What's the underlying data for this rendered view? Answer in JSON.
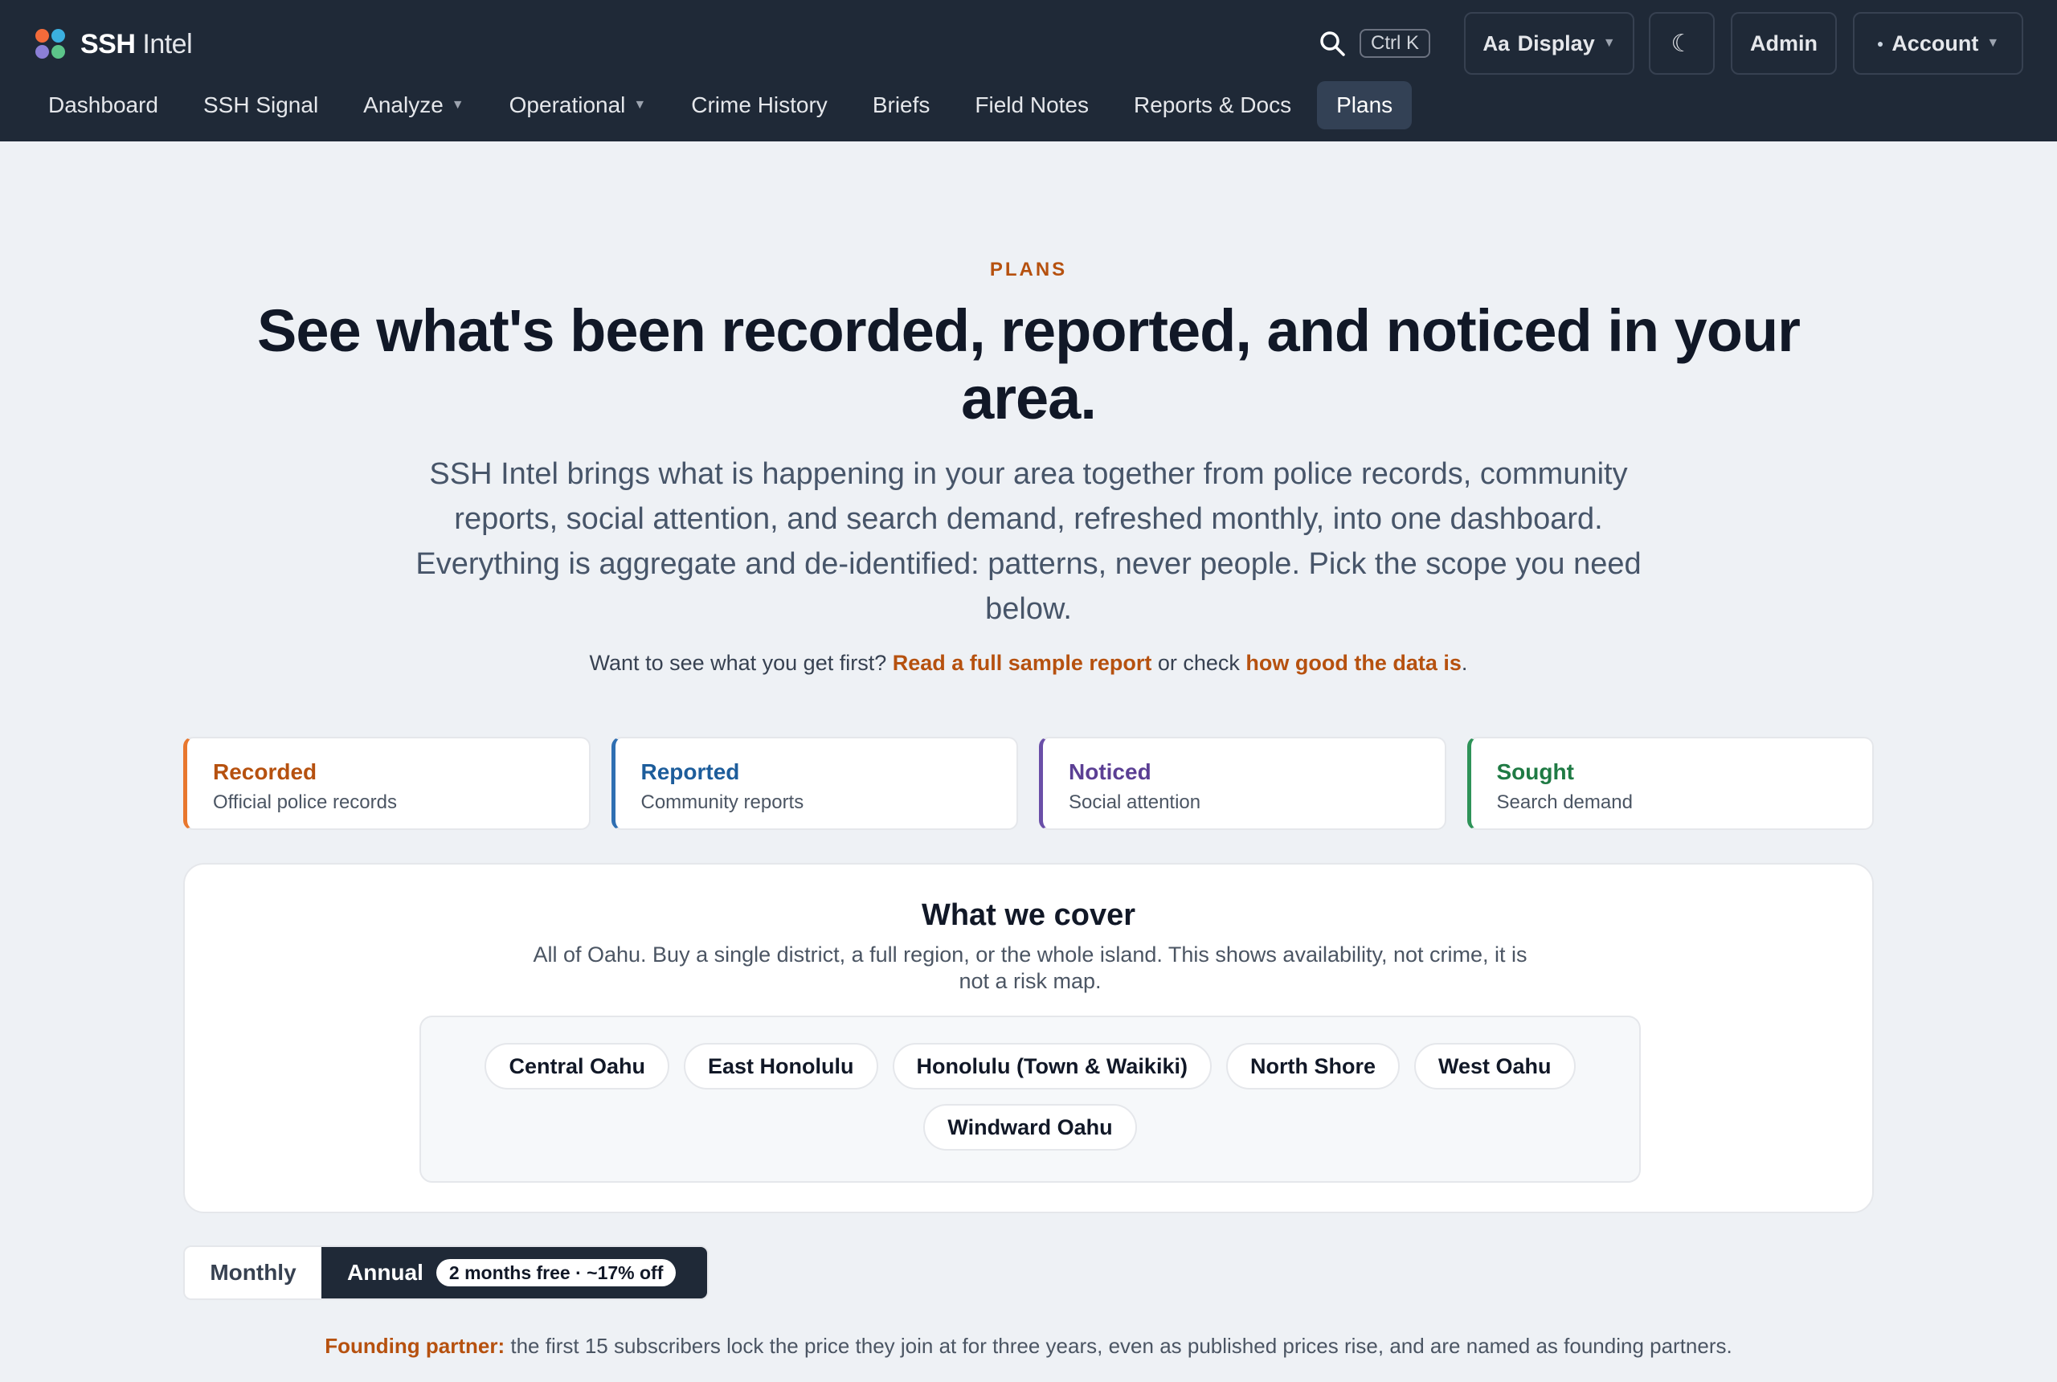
{
  "app": {
    "brand_bold": "SSH",
    "brand_thin": "Intel",
    "search_shortcut": "Ctrl K",
    "display_label": "Display",
    "display_icon_text": "Aa",
    "theme_icon": "moon-icon",
    "admin_label": "Admin",
    "account_label": "Account"
  },
  "nav": {
    "items": [
      {
        "label": "Dashboard",
        "dropdown": false
      },
      {
        "label": "SSH Signal",
        "dropdown": false
      },
      {
        "label": "Analyze",
        "dropdown": true
      },
      {
        "label": "Operational",
        "dropdown": true
      },
      {
        "label": "Crime History",
        "dropdown": false
      },
      {
        "label": "Briefs",
        "dropdown": false
      },
      {
        "label": "Field Notes",
        "dropdown": false
      },
      {
        "label": "Reports & Docs",
        "dropdown": false
      },
      {
        "label": "Plans",
        "dropdown": false,
        "active": true
      }
    ]
  },
  "hero": {
    "eyebrow": "PLANS",
    "title": "See what's been recorded, reported, and noticed in your area.",
    "subtitle": "SSH Intel brings what is happening in your area together from police records, community reports, social attention, and search demand, refreshed monthly, into one dashboard. Everything is aggregate and de-identified: patterns, never people. Pick the scope you need below.",
    "cta_prefix": "Want to see what you get first?",
    "cta_link1": "Read a full sample report",
    "cta_mid": "or check",
    "cta_link2": "how good the data is",
    "cta_suffix": "."
  },
  "sources": [
    {
      "title": "Recorded",
      "desc": "Official police records",
      "color": "#b6510f",
      "border": "#e8772e"
    },
    {
      "title": "Reported",
      "desc": "Community reports",
      "color": "#1d5d9b",
      "border": "#2f6fb2"
    },
    {
      "title": "Noticed",
      "desc": "Social attention",
      "color": "#5b3f94",
      "border": "#6a4fa8"
    },
    {
      "title": "Sought",
      "desc": "Search demand",
      "color": "#1f7a44",
      "border": "#2e9358"
    }
  ],
  "coverage": {
    "title": "What we cover",
    "desc": "All of Oahu. Buy a single district, a full region, or the whole island. This shows availability, not crime, it is not a risk map.",
    "regions": [
      "Central Oahu",
      "East Honolulu",
      "Honolulu (Town & Waikiki)",
      "North Shore",
      "West Oahu",
      "Windward Oahu"
    ]
  },
  "billing": {
    "monthly_label": "Monthly",
    "annual_label": "Annual",
    "annual_badge": "2 months free · ~17% off",
    "selected": "Annual"
  },
  "founding": {
    "lead": "Founding partner:",
    "text": "the first 15 subscribers lock the price they join at for three years, even as published prices rise, and are named as founding partners."
  }
}
